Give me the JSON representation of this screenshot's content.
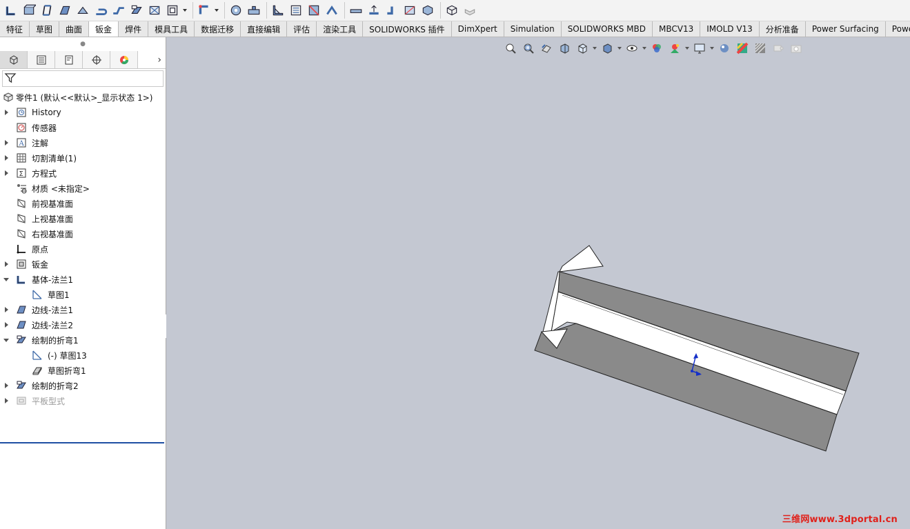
{
  "toolbar": {
    "icons": [
      "base-flange-icon",
      "convert-to-sheet-metal-icon",
      "lofted-bend-icon",
      "edge-flange-icon",
      "miter-flange-icon",
      "hem-icon",
      "jog-icon",
      "sketched-bend-icon",
      "cross-break-icon",
      "extruded-cut-icon",
      "corner-icon",
      "forming-tool-icon",
      "tab-slot-icon",
      "gusset-icon",
      "vent-icon",
      "rip-icon",
      "insert-bends-icon",
      "flatten-icon",
      "unfold-icon",
      "fold-icon",
      "no-bends-icon",
      "solid-to-sheet-icon",
      "sheet-metal-icon",
      "flatten-grey-icon"
    ]
  },
  "tabs": [
    "特征",
    "草图",
    "曲面",
    "钣金",
    "焊件",
    "模具工具",
    "数据迁移",
    "直接编辑",
    "评估",
    "渲染工具",
    "SOLIDWORKS 插件",
    "DimXpert",
    "Simulation",
    "SOLIDWORKS MBD",
    "MBCV13",
    "IMOLD V13",
    "分析准备",
    "Power Surfacing",
    "Power Su"
  ],
  "active_tab": "钣金",
  "panel": {
    "tabs": [
      "featuremanager-icon",
      "propertymanager-icon",
      "configurationmanager-icon",
      "dimxpertmanager-icon",
      "displaymanager-icon"
    ],
    "more": "›",
    "root": "零件1  (默认<<默认>_显示状态 1>)",
    "tree": [
      {
        "label": "History",
        "expand": "closed",
        "icon": "history-icon",
        "indent": 0
      },
      {
        "label": "传感器",
        "expand": "none",
        "icon": "sensor-icon",
        "indent": 0
      },
      {
        "label": "注解",
        "expand": "closed",
        "icon": "annotation-icon",
        "indent": 0
      },
      {
        "label": "切割清单(1)",
        "expand": "closed",
        "icon": "cut-list-icon",
        "indent": 0
      },
      {
        "label": "方程式",
        "expand": "closed",
        "icon": "equation-icon",
        "indent": 0
      },
      {
        "label": "材质 <未指定>",
        "expand": "none",
        "icon": "material-icon",
        "indent": 0
      },
      {
        "label": "前视基准面",
        "expand": "none",
        "icon": "plane-icon",
        "indent": 0
      },
      {
        "label": "上视基准面",
        "expand": "none",
        "icon": "plane-icon",
        "indent": 0
      },
      {
        "label": "右视基准面",
        "expand": "none",
        "icon": "plane-icon",
        "indent": 0
      },
      {
        "label": "原点",
        "expand": "none",
        "icon": "origin-icon",
        "indent": 0
      },
      {
        "label": "钣金",
        "expand": "closed",
        "icon": "sheet-metal-folder-icon",
        "indent": 0
      },
      {
        "label": "基体-法兰1",
        "expand": "open",
        "icon": "base-flange-icon",
        "indent": 0
      },
      {
        "label": "草图1",
        "expand": "none",
        "icon": "sketch-icon",
        "indent": 1
      },
      {
        "label": "边线-法兰1",
        "expand": "closed",
        "icon": "edge-flange-icon",
        "indent": 0
      },
      {
        "label": "边线-法兰2",
        "expand": "closed",
        "icon": "edge-flange-icon",
        "indent": 0
      },
      {
        "label": "绘制的折弯1",
        "expand": "open",
        "icon": "sketched-bend-icon",
        "indent": 0
      },
      {
        "label": "(-) 草图13",
        "expand": "none",
        "icon": "sketch-icon",
        "indent": 1
      },
      {
        "label": "草图折弯1",
        "expand": "none",
        "icon": "sketch-bend-icon",
        "indent": 1
      },
      {
        "label": "绘制的折弯2",
        "expand": "closed",
        "icon": "sketched-bend-icon",
        "indent": 0
      },
      {
        "label": "平板型式",
        "expand": "closed",
        "icon": "flat-pattern-icon",
        "indent": 0,
        "dim": true
      }
    ]
  },
  "viewport": {
    "heads_up": [
      "zoom-to-fit-icon",
      "zoom-to-area-icon",
      "previous-view-icon",
      "section-view-icon",
      "view-orientation-icon",
      "display-style-icon",
      "hide-show-items-icon",
      "edit-appearance-icon",
      "apply-scene-icon",
      "view-settings-icon",
      "realview-icon",
      "shadows-icon",
      "ambient-occlusion-icon",
      "perspective-icon",
      "camera-icon"
    ],
    "watermark": "三维网www.3dportal.cn"
  },
  "colors": {
    "viewport_bg": "#c4c8d2",
    "part_grey": "#8a8a8a",
    "part_white": "#ffffff",
    "rollback_bar": "#1f4ea3",
    "watermark": "#e0201a"
  }
}
